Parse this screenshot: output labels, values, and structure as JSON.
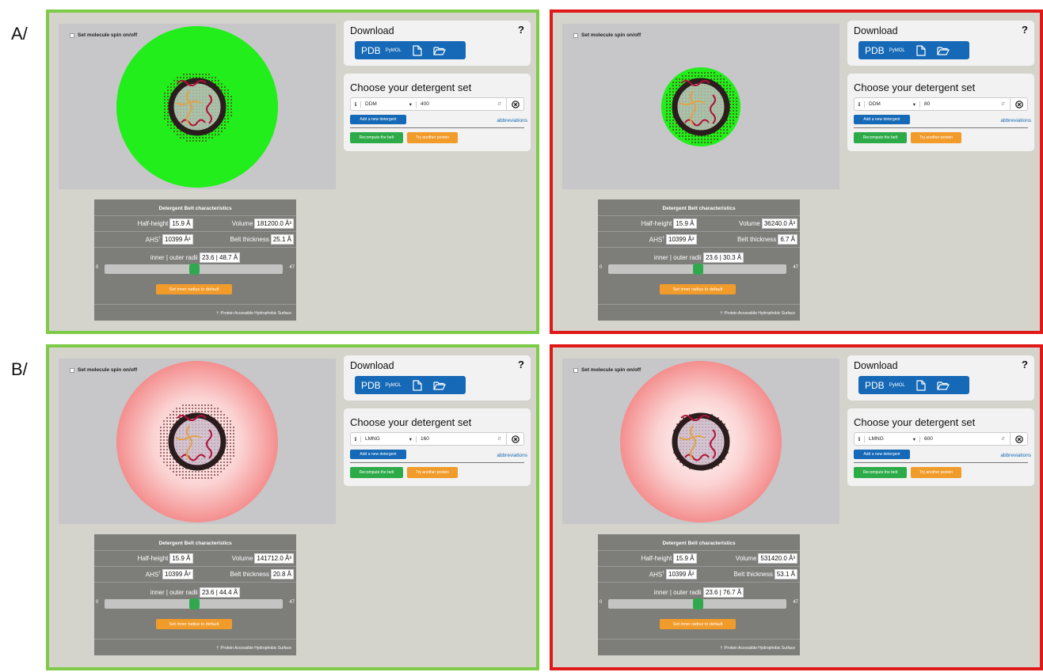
{
  "row_labels": [
    "A/",
    "B/"
  ],
  "common": {
    "spin_label": "Set molecule spin on/off",
    "download_title": "Download",
    "help": "?",
    "pdb_label": "PDB",
    "pymol_label": "PyMOL",
    "detergent_title": "Choose your detergent set",
    "info": "i",
    "add_detergent": "Add a new detergent",
    "abbreviations": "abbreviations",
    "recompute": "Recompute the belt",
    "try_another": "Try another protein",
    "belt_title": "Detergent Belt characteristics",
    "half_height_label": "Half-height",
    "volume_label": "Volume",
    "ahs_label": "AHS",
    "ahs_sup": "†",
    "belt_thickness_label": "Belt thickness",
    "radii_label": "inner | outer radii",
    "slider_min": "0",
    "slider_max": "47",
    "reset_button": "Set inner radius to default",
    "footnote": "† :Protein Accessible Hydrophobic Surface",
    "colors": {
      "green_border": "#7ecb48",
      "red_border": "#e01818",
      "accent_blue": "#1569b6",
      "accent_orange": "#f19b2b",
      "accent_green": "#2eab49"
    }
  },
  "panels": [
    {
      "name": "A-left",
      "detergent": "DDM",
      "count": "400",
      "half_height": "15.9 Å",
      "volume": "181200.0 Å³",
      "ahs": "10399 Å²",
      "belt_thickness": "25.1 Å",
      "radii": "23.6 | 48.7 Å",
      "slider_value": 23.6,
      "belt_color": "#22ee1c",
      "belt_style": "flat",
      "border": "green"
    },
    {
      "name": "A-right",
      "detergent": "DDM",
      "count": "80",
      "half_height": "15.9 Å",
      "volume": "36240.0 Å³",
      "ahs": "10399 Å²",
      "belt_thickness": "6.7 Å",
      "radii": "23.6 | 30.3 Å",
      "slider_value": 23.6,
      "belt_color": "#22ee1c",
      "belt_style": "flat",
      "border": "red"
    },
    {
      "name": "B-left",
      "detergent": "LMNG",
      "count": "160",
      "half_height": "15.9 Å",
      "volume": "141712.0 Å³",
      "ahs": "10399 Å²",
      "belt_thickness": "20.8 Å",
      "radii": "23.6 | 44.4 Å",
      "slider_value": 23.6,
      "belt_color": "#f7a3a3",
      "belt_style": "gradient",
      "border": "green"
    },
    {
      "name": "B-right",
      "detergent": "LMNG",
      "count": "600",
      "half_height": "15.9 Å",
      "volume": "531420.0 Å³",
      "ahs": "10399 Å²",
      "belt_thickness": "53.1 Å",
      "radii": "23.6 | 76.7 Å",
      "slider_value": 23.6,
      "belt_color": "#f7a3a3",
      "belt_style": "gradient",
      "border": "red"
    }
  ]
}
